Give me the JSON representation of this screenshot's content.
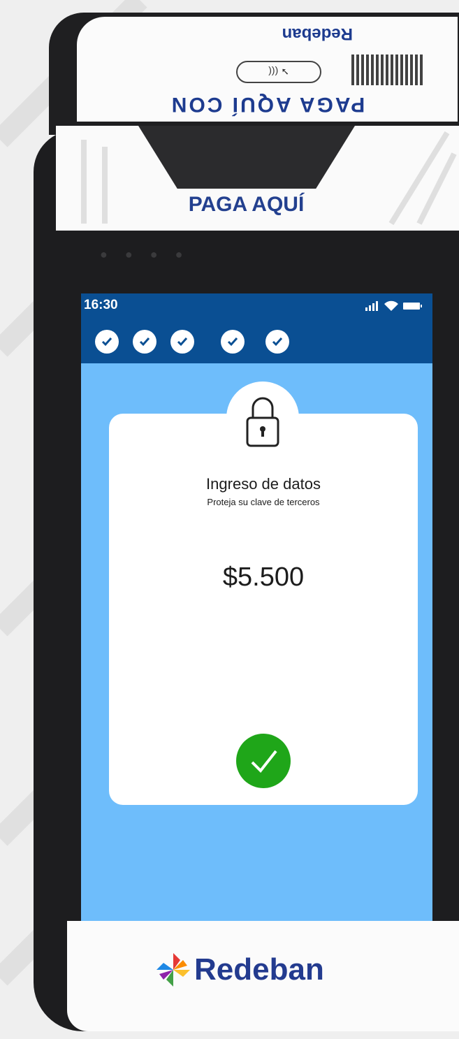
{
  "device": {
    "top_label_reversed": "PAGA AQUÍ CON",
    "top_label_brand": "Redeban",
    "nfc_label": "((( ",
    "sensor_label": "PAGA AQUÍ"
  },
  "status_bar": {
    "time": "16:30"
  },
  "progress": {
    "completed_steps": 5,
    "steps": [
      "step-1",
      "step-2",
      "step-3",
      "step-4",
      "step-5"
    ]
  },
  "card": {
    "icon": "lock-icon",
    "title": "Ingreso de datos",
    "subtitle": "Proteja su clave de terceros",
    "amount": "$5.500",
    "status_icon": "check-icon"
  },
  "footer": {
    "brand": "Redeban"
  },
  "colors": {
    "status_bar": "#0a4f93",
    "screen_bg": "#6ebdfb",
    "success": "#1fa619",
    "brand_blue": "#233b8f"
  }
}
